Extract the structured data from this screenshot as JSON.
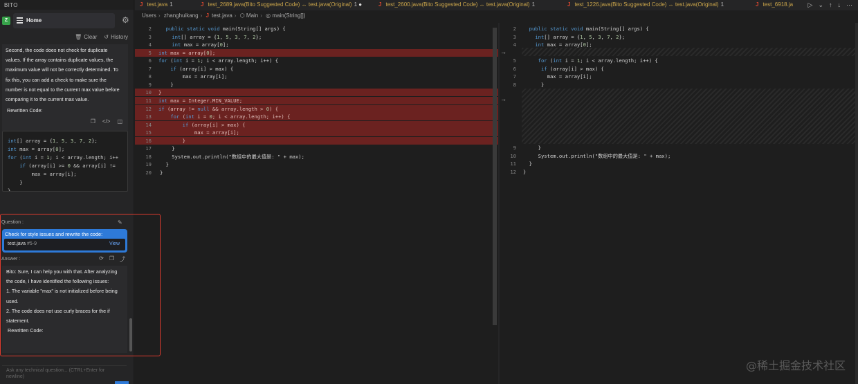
{
  "bito": {
    "title": "BITO",
    "avatar": "Z",
    "home_label": "Home",
    "clear_label": "Clear",
    "history_label": "History",
    "prev_answer_text": "Second, the code does not check for duplicate values. If the array contains duplicate values, the maximum value will not be correctly determined. To fix this, you can add a check to make sure the number is not equal to the current max value before comparing it to the current max value.",
    "rewritten_label": "Rewritten Code:",
    "code_lines": [
      "int[] array = {1, 5, 3, 7, 2};",
      "int max = array[0];",
      "for (int i = 1; i < array.length; i++",
      "    if (array[i] >= 0 && array[i] !=",
      "        max = array[i];",
      "    }",
      "}"
    ],
    "question_label": "Question :",
    "question_text": "Check for style issues and rewrite the code:",
    "question_file": "test.java",
    "question_lines": "#5-9",
    "question_view": "View",
    "answer_label": "Answer :",
    "answer_text": "Bito: Sure, I can help you with that. After analyzing the code, I have identified the following issues:",
    "answer_item1": "1. The variable \"max\" is not initialized before being used.",
    "answer_item2": "2. The code does not use curly braces for the if statement.",
    "answer_rewritten": "Rewritten Code:",
    "ask_placeholder": "Ask any technical question... (CTRL+Enter for newline)"
  },
  "tabs": [
    {
      "name": "test.java",
      "count": "1"
    },
    {
      "name": "test_2689.java(Bito Suggested Code) ↔ test.java(Original)",
      "count": "1"
    },
    {
      "name": "test_2600.java(Bito Suggested Code) ↔ test.java(Original)",
      "count": "1"
    },
    {
      "name": "test_1226.java(Bito Suggested Code) ↔ test.java(Original)",
      "count": "1"
    },
    {
      "name": "test_6918.ja",
      "count": ""
    }
  ],
  "breadcrumb": {
    "users": "Users",
    "user": "zhanghuikang",
    "file": "test.java",
    "cls": "Main",
    "method": "main(String[])"
  },
  "left_editor": [
    {
      "n": "2",
      "code": "  public static void main(String[] args) {",
      "del": false
    },
    {
      "n": "3",
      "code": "    int[] array = {1, 5, 3, 7, 2};",
      "del": false
    },
    {
      "n": "4",
      "code": "    int max = array[0];",
      "del": false
    },
    {
      "n": "5",
      "code": "int max = array[0];",
      "del": true
    },
    {
      "n": "6",
      "code": "for (int i = 1; i < array.length; i++) {",
      "del": false
    },
    {
      "n": "7",
      "code": "    if (array[i] > max) {",
      "del": false
    },
    {
      "n": "8",
      "code": "        max = array[i];",
      "del": false
    },
    {
      "n": "9",
      "code": "    }",
      "del": false
    },
    {
      "n": "10",
      "code": "}",
      "del": true
    },
    {
      "n": "11",
      "code": "int max = Integer.MIN_VALUE;",
      "del": true
    },
    {
      "n": "12",
      "code": "if (array != null && array.length > 0) {",
      "del": true
    },
    {
      "n": "13",
      "code": "    for (int i = 0; i < array.length; i++) {",
      "del": true
    },
    {
      "n": "14",
      "code": "        if (array[i] > max) {",
      "del": true
    },
    {
      "n": "15",
      "code": "            max = array[i];",
      "del": true
    },
    {
      "n": "16",
      "code": "        }",
      "del": true
    },
    {
      "n": "17",
      "code": "    }",
      "del": false
    },
    {
      "n": "18",
      "code": "    System.out.println(\"数组中的最大值是: \" + max);",
      "del": false
    },
    {
      "n": "19",
      "code": "  }",
      "del": false
    },
    {
      "n": "20",
      "code": "}",
      "del": false
    }
  ],
  "right_editor": [
    {
      "n": "2",
      "code": "  public static void main(String[] args) {"
    },
    {
      "n": "3",
      "code": "    int[] array = {1, 5, 3, 7, 2};"
    },
    {
      "n": "4",
      "code": "    int max = array[0];"
    },
    {
      "n": "",
      "code": ""
    },
    {
      "n": "5",
      "code": "     for (int i = 1; i < array.length; i++) {"
    },
    {
      "n": "6",
      "code": "      if (array[i] > max) {"
    },
    {
      "n": "7",
      "code": "        max = array[i];"
    },
    {
      "n": "8",
      "code": "      }"
    },
    {
      "n": "",
      "code": ""
    },
    {
      "n": "9",
      "code": "     }"
    },
    {
      "n": "10",
      "code": "     System.out.println(\"数组中的最大值是: \" + max);"
    },
    {
      "n": "11",
      "code": "  }"
    },
    {
      "n": "12",
      "code": "}"
    }
  ],
  "watermark": "@稀土掘金技术社区",
  "colors": {
    "deleted_bg": "#6b2220",
    "accent": "#2e7ad8",
    "highlight_border": "#e03b2e"
  }
}
